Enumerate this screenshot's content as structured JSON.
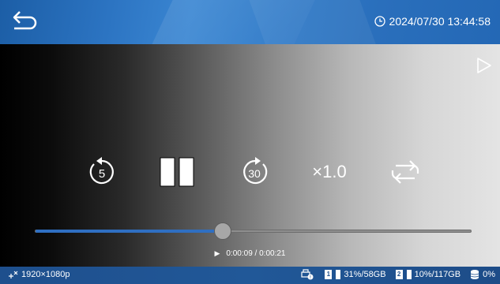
{
  "header": {
    "datetime": "2024/07/30 13:44:58",
    "icons": {
      "back": "back-arrow-icon",
      "clock": "clock-icon"
    }
  },
  "player": {
    "controls": {
      "rewind_seconds": "5",
      "forward_seconds": "30",
      "speed_label": "×1.0"
    },
    "progress": {
      "fraction": 0.43,
      "current": "0:00:09",
      "total": "0:00:21",
      "separator": " / "
    }
  },
  "status_bar": {
    "resolution": "1920×1080p",
    "card1_index": "1",
    "card1_usage": "31%/58GB",
    "card2_index": "2",
    "card2_usage": "10%/117GB",
    "storage_usage": "0%",
    "colors": {
      "bar": "#215898",
      "progress": "#2f6fc2",
      "header": "#2c74c2"
    }
  }
}
